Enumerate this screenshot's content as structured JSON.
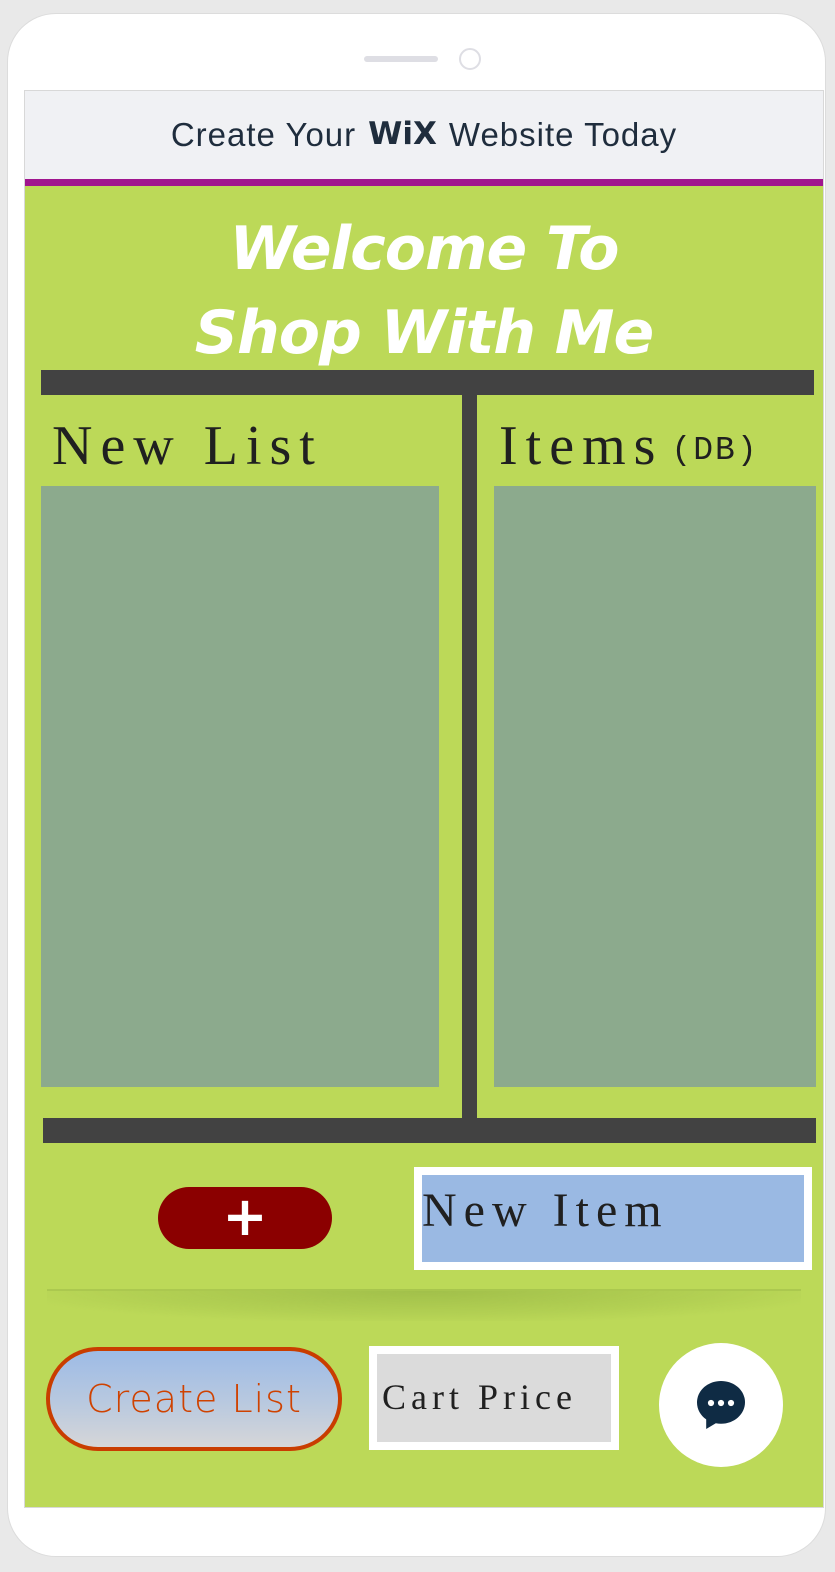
{
  "banner": {
    "text_before": "Create Your",
    "logo_text": "WiX",
    "text_after": "Website Today"
  },
  "page": {
    "welcome_title": "Welcome To\nShop With Me"
  },
  "lists": {
    "new_list_heading": "New List",
    "items_heading": "Items",
    "items_heading_suffix": "(DB)"
  },
  "actions": {
    "add_icon": "+",
    "new_item_text": "New Item",
    "create_list_label": "Create List",
    "cart_price_label": "Cart Price"
  },
  "icons": {
    "add": "plus-icon",
    "chat": "chat-icon"
  },
  "colors": {
    "background": "#bcd958",
    "banner_border": "#a0158e",
    "divider": "#424242",
    "panel": "#8caa8d",
    "add_button": "#8b0000",
    "new_item_fill": "#9ab9e3",
    "create_list_border": "#c93d00",
    "chat_icon": "#0f2b44"
  }
}
